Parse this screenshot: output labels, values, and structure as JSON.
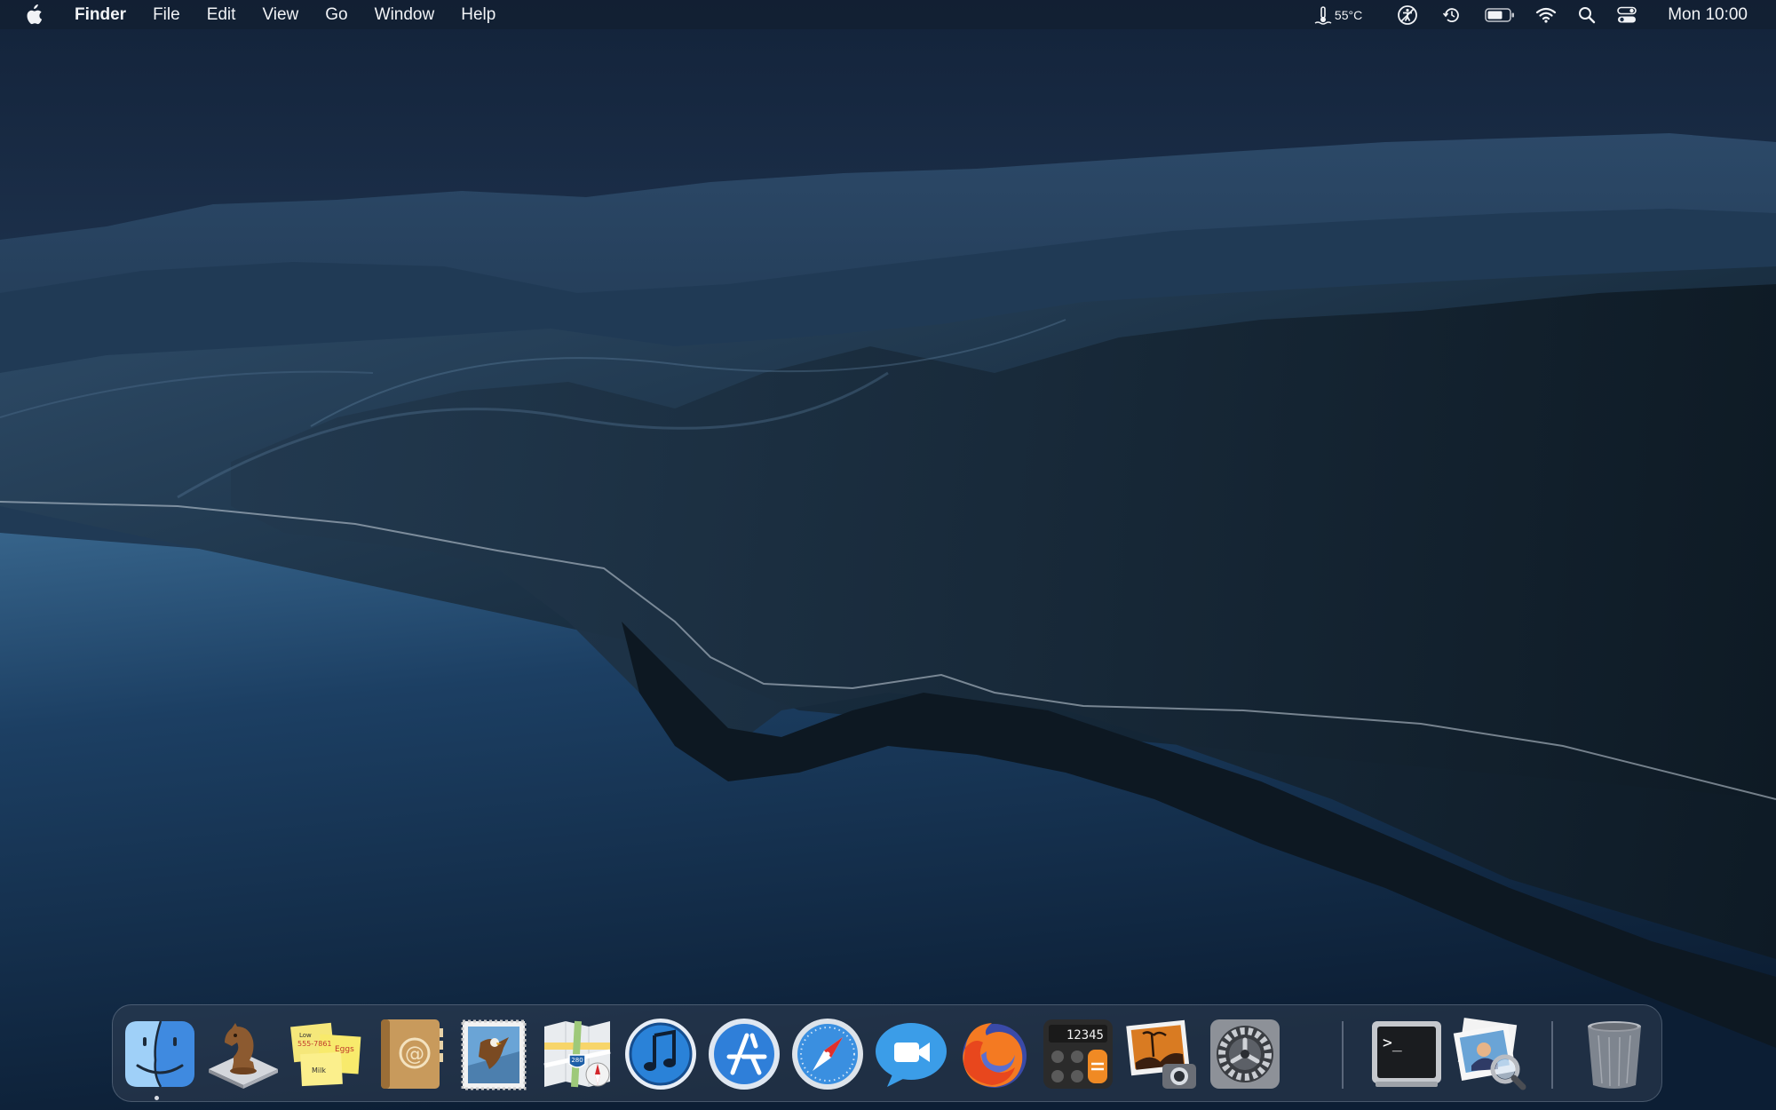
{
  "menubar": {
    "app_name": "Finder",
    "menus": [
      "File",
      "Edit",
      "View",
      "Go",
      "Window",
      "Help"
    ],
    "status": {
      "temperature": "55°C",
      "clock": "Mon 10:00",
      "icons": [
        "thermometer-icon",
        "accessibility-icon",
        "time-machine-icon",
        "battery-icon",
        "wifi-icon",
        "spotlight-search-icon",
        "control-center-icon"
      ]
    }
  },
  "dock": {
    "apps": [
      {
        "name": "Finder",
        "icon": "finder-icon",
        "running": true
      },
      {
        "name": "Chess",
        "icon": "chess-knight-icon"
      },
      {
        "name": "Stickies",
        "icon": "stickies-icon",
        "note_text": [
          "Low",
          "555-7861",
          "Eggs",
          "Milk"
        ]
      },
      {
        "name": "Contacts",
        "icon": "address-book-icon"
      },
      {
        "name": "Mail",
        "icon": "mail-stamp-icon"
      },
      {
        "name": "Maps",
        "icon": "maps-icon",
        "badge": "280"
      },
      {
        "name": "iTunes",
        "icon": "itunes-icon"
      },
      {
        "name": "App Store",
        "icon": "app-store-icon"
      },
      {
        "name": "Safari",
        "icon": "safari-icon"
      },
      {
        "name": "FaceTime",
        "icon": "facetime-icon"
      },
      {
        "name": "Firefox",
        "icon": "firefox-icon"
      },
      {
        "name": "Calculator",
        "icon": "calculator-icon",
        "display": "12345"
      },
      {
        "name": "Image Capture",
        "icon": "image-capture-icon"
      },
      {
        "name": "System Preferences",
        "icon": "system-preferences-icon"
      },
      {
        "name": "Terminal",
        "icon": "terminal-icon",
        "prompt": ">_"
      },
      {
        "name": "Preview",
        "icon": "preview-icon"
      },
      {
        "name": "Trash",
        "icon": "trash-icon"
      }
    ]
  },
  "colors": {
    "sky_top": "#1b2e4a",
    "sea": "#16304f",
    "mountains": "#203a55",
    "menubar_text": "#f1f3f6"
  }
}
